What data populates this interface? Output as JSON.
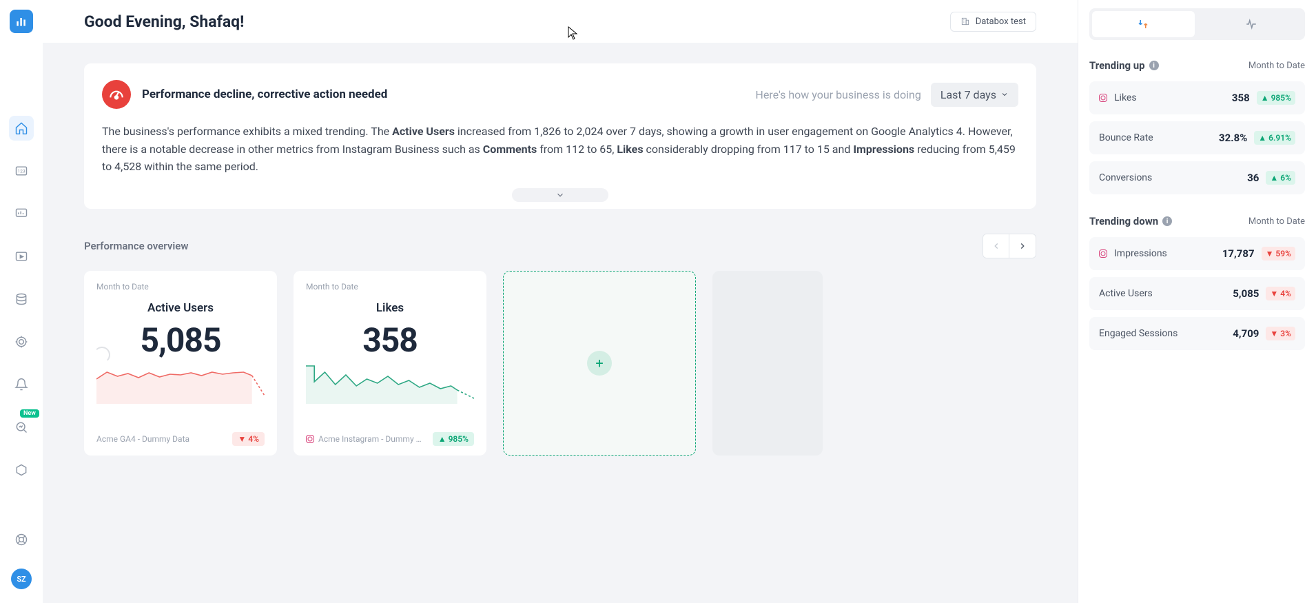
{
  "header": {
    "greeting": "Good Evening, Shafaq!",
    "workspace_label": "Databox test"
  },
  "insight": {
    "title": "Performance decline, corrective action needed",
    "subtitle": "Here's how your business is doing",
    "range": "Last 7 days",
    "body_parts": {
      "p1": "The business's performance exhibits a mixed trending. The ",
      "b1": "Active Users",
      "p2": " increased from 1,826 to 2,024 over 7 days, showing a growth in user engagement on Google Analytics 4. However, there is a notable decrease in other metrics from Instagram Business such as ",
      "b2": "Comments",
      "p3": " from 112 to 65, ",
      "b3": "Likes",
      "p4": " considerably dropping from 117 to 15 and ",
      "b4": "Impressions",
      "p5": " reducing from 5,459 to 4,528 within the same period."
    }
  },
  "overview": {
    "title": "Performance overview",
    "cards": [
      {
        "period": "Month to Date",
        "name": "Active Users",
        "value": "5,085",
        "source": "Acme GA4 - Dummy Data",
        "delta": "4%",
        "direction": "down",
        "color": "#ef6a65"
      },
      {
        "period": "Month to Date",
        "name": "Likes",
        "value": "358",
        "source": "Acme Instagram - Dummy …",
        "delta": "985%",
        "direction": "up",
        "color": "#2ea884",
        "source_icon": "instagram"
      }
    ]
  },
  "sidebar": {
    "range": "Month to Date",
    "up_title": "Trending up",
    "down_title": "Trending down",
    "up": [
      {
        "name": "Likes",
        "value": "358",
        "delta": "985%",
        "icon": "instagram"
      },
      {
        "name": "Bounce Rate",
        "value": "32.8%",
        "delta": "6.91%"
      },
      {
        "name": "Conversions",
        "value": "36",
        "delta": "6%"
      }
    ],
    "down": [
      {
        "name": "Impressions",
        "value": "17,787",
        "delta": "59%",
        "icon": "instagram"
      },
      {
        "name": "Active Users",
        "value": "5,085",
        "delta": "4%"
      },
      {
        "name": "Engaged Sessions",
        "value": "4,709",
        "delta": "3%"
      }
    ]
  },
  "avatar": "SZ",
  "new_label": "New",
  "chart_data": [
    {
      "type": "line",
      "title": "Active Users sparkline",
      "values": [
        210,
        240,
        225,
        235,
        220,
        238,
        222,
        232,
        230,
        235,
        228,
        236,
        230,
        238,
        225,
        150
      ],
      "color": "#ef6a65"
    },
    {
      "type": "line",
      "title": "Likes sparkline",
      "values": [
        54,
        28,
        40,
        22,
        36,
        20,
        30,
        24,
        34,
        22,
        28,
        18,
        24,
        16,
        20,
        14,
        10
      ],
      "color": "#2ea884"
    }
  ]
}
